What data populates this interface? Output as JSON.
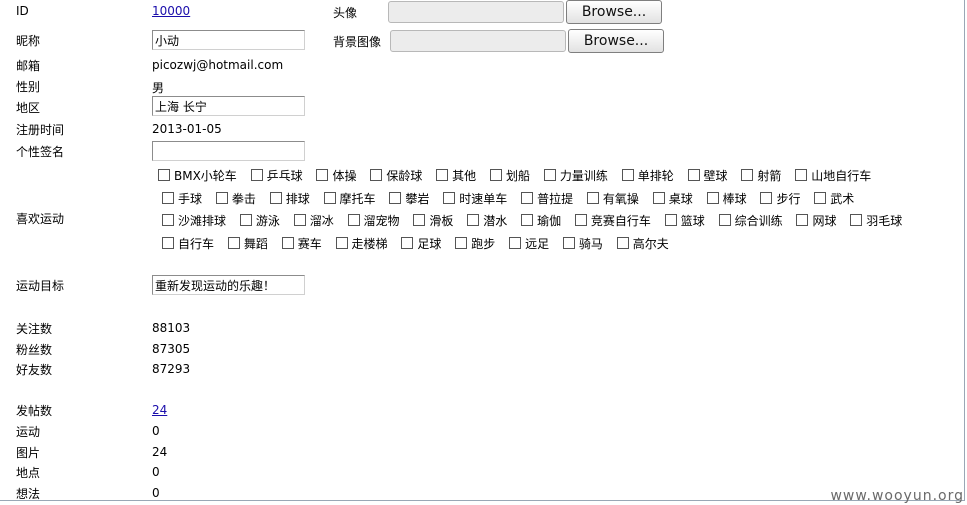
{
  "profile": {
    "id_label": "ID",
    "id_value": "10000",
    "avatar_label": "头像",
    "browse_label": "Browse...",
    "nickname_label": "昵称",
    "nickname_value": "小动",
    "bg_label": "背景图像",
    "email_label": "邮箱",
    "email_value": "picozwj@hotmail.com",
    "gender_label": "性别",
    "gender_value": "男",
    "region_label": "地区",
    "region_value": "上海 长宁",
    "reg_label": "注册时间",
    "reg_value": "2013-01-05",
    "sign_label": "个性签名",
    "sign_value": "",
    "sports_label": "喜欢运动",
    "goal_label": "运动目标",
    "goal_value": "重新发现运动的乐趣！"
  },
  "sports": [
    "BMX小轮车",
    "乒乓球",
    "体操",
    "保龄球",
    "其他",
    "划船",
    "力量训练",
    "单排轮",
    "壁球",
    "射箭",
    "山地自行车",
    "手球",
    "拳击",
    "排球",
    "摩托车",
    "攀岩",
    "时速单车",
    "普拉提",
    "有氧操",
    "桌球",
    "棒球",
    "步行",
    "武术",
    "沙滩排球",
    "游泳",
    "溜冰",
    "溜宠物",
    "滑板",
    "潜水",
    "瑜伽",
    "竞赛自行车",
    "篮球",
    "综合训练",
    "网球",
    "羽毛球",
    "自行车",
    "舞蹈",
    "赛车",
    "走楼梯",
    "足球",
    "跑步",
    "远足",
    "骑马",
    "高尔夫"
  ],
  "stats": {
    "follow_label": "关注数",
    "follow_value": "88103",
    "fans_label": "粉丝数",
    "fans_value": "87305",
    "friends_label": "好友数",
    "friends_value": "87293",
    "posts_label": "发帖数",
    "posts_value": "24",
    "sport_label": "运动",
    "sport_value": "0",
    "photo_label": "图片",
    "photo_value": "24",
    "place_label": "地点",
    "place_value": "0",
    "idea_label": "想法",
    "idea_value": "0"
  },
  "watermark": "www.wooyun.org"
}
